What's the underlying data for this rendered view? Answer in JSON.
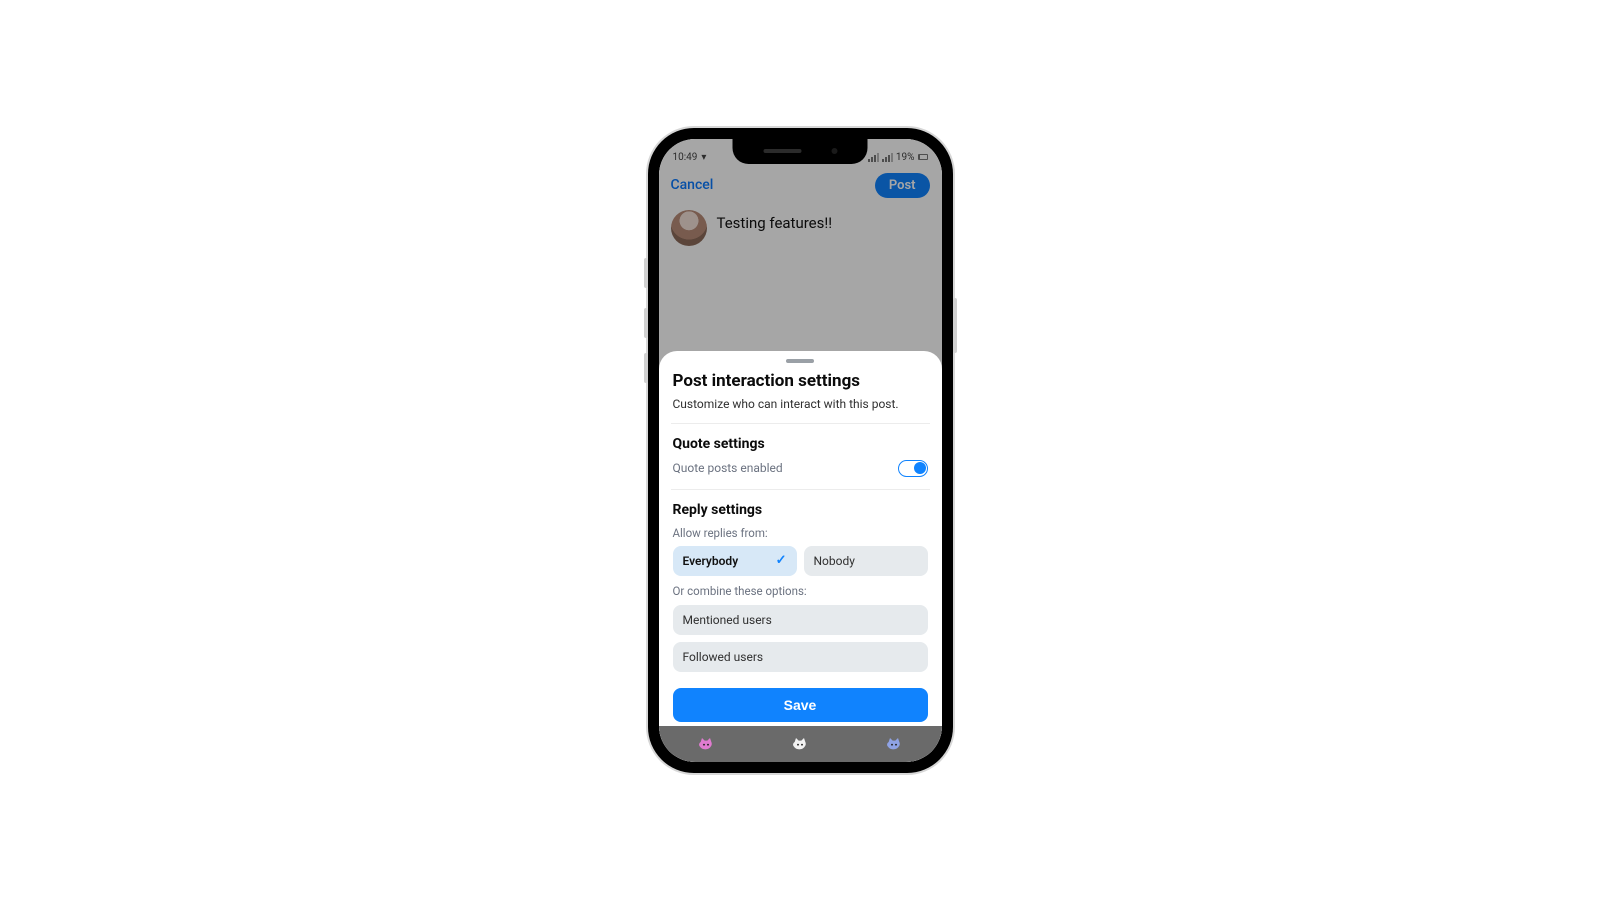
{
  "statusbar": {
    "time": "10:49",
    "battery": "19%"
  },
  "compose": {
    "cancel": "Cancel",
    "post": "Post",
    "text": "Testing features!!"
  },
  "sheet": {
    "title": "Post interaction settings",
    "subtitle": "Customize who can interact with this post.",
    "quote": {
      "section": "Quote settings",
      "label": "Quote posts enabled",
      "enabled": true
    },
    "reply": {
      "section": "Reply settings",
      "allow_label": "Allow replies from:",
      "options": {
        "everybody": "Everybody",
        "nobody": "Nobody"
      },
      "selected": "everybody",
      "combine_label": "Or combine these options:",
      "combine": {
        "mentioned": "Mentioned users",
        "followed": "Followed users"
      }
    },
    "save": "Save"
  }
}
